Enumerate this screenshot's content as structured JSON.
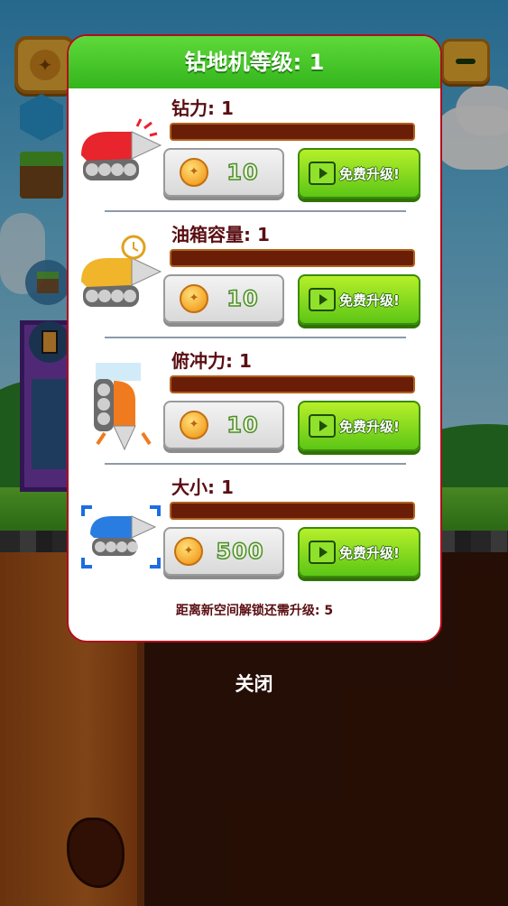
{
  "modal": {
    "title": "钻地机等级: 1",
    "footer": "距离新空间解锁还需升级: 5",
    "upgrades": [
      {
        "label": "钻力: 1",
        "cost": "10",
        "free_label": "免费升级!",
        "progress": 0,
        "drill_color": "#e8242c"
      },
      {
        "label": "油箱容量: 1",
        "cost": "10",
        "free_label": "免费升级!",
        "progress": 0,
        "drill_color": "#f0b52a"
      },
      {
        "label": "俯冲力: 1",
        "cost": "10",
        "free_label": "免费升级!",
        "progress": 0,
        "drill_color": "#f07a1e"
      },
      {
        "label": "大小: 1",
        "cost": "500",
        "free_label": "免费升级!",
        "progress": 0,
        "drill_color": "#2a7de0"
      }
    ]
  },
  "close_label": "关闭",
  "colors": {
    "header_green": "#4ccb2b",
    "progress_track": "#6a1e07",
    "label_text": "#5a0e12"
  },
  "icons": {
    "hud": [
      "drill-upgrade-icon",
      "gem-icon",
      "grass-block-icon",
      "minimize-icon"
    ],
    "buttons": [
      "coin-icon",
      "video-play-icon"
    ]
  }
}
